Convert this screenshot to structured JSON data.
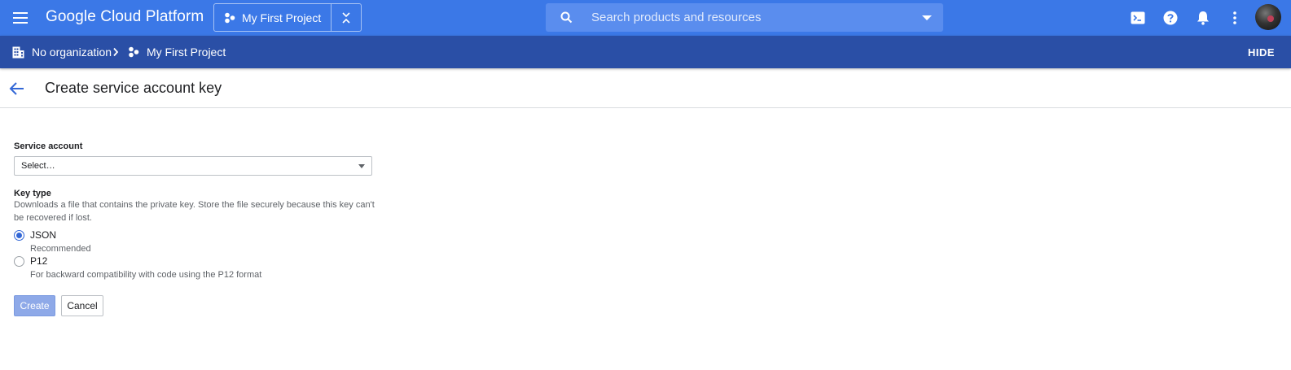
{
  "appbar": {
    "brand": "Google Cloud Platform",
    "project_name": "My First Project",
    "search_placeholder": "Search products and resources",
    "icons": [
      "menu-icon",
      "project-dots-icon",
      "project-switch-icon",
      "search-icon",
      "cloud-shell-icon",
      "help-icon",
      "notifications-icon",
      "more-vert-icon",
      "avatar"
    ]
  },
  "breadcrumb": {
    "organization": "No organization",
    "project": "My First Project",
    "hide_label": "HIDE"
  },
  "page": {
    "title": "Create service account key"
  },
  "form": {
    "service_account_label": "Service account",
    "service_account_value": "Select…",
    "key_type_label": "Key type",
    "key_type_help": "Downloads a file that contains the private key. Store the file securely because this key can't be recovered if lost.",
    "options": [
      {
        "label": "JSON",
        "sub": "Recommended",
        "checked": true
      },
      {
        "label": "P12",
        "sub": "For backward compatibility with code using the P12 format",
        "checked": false
      }
    ],
    "create_label": "Create",
    "cancel_label": "Cancel"
  },
  "colors": {
    "appbar": "#3b78e7",
    "breadcrumb_bar": "#2a4fa6",
    "accent": "#3367d6",
    "create_disabled": "#8ea9e8"
  }
}
